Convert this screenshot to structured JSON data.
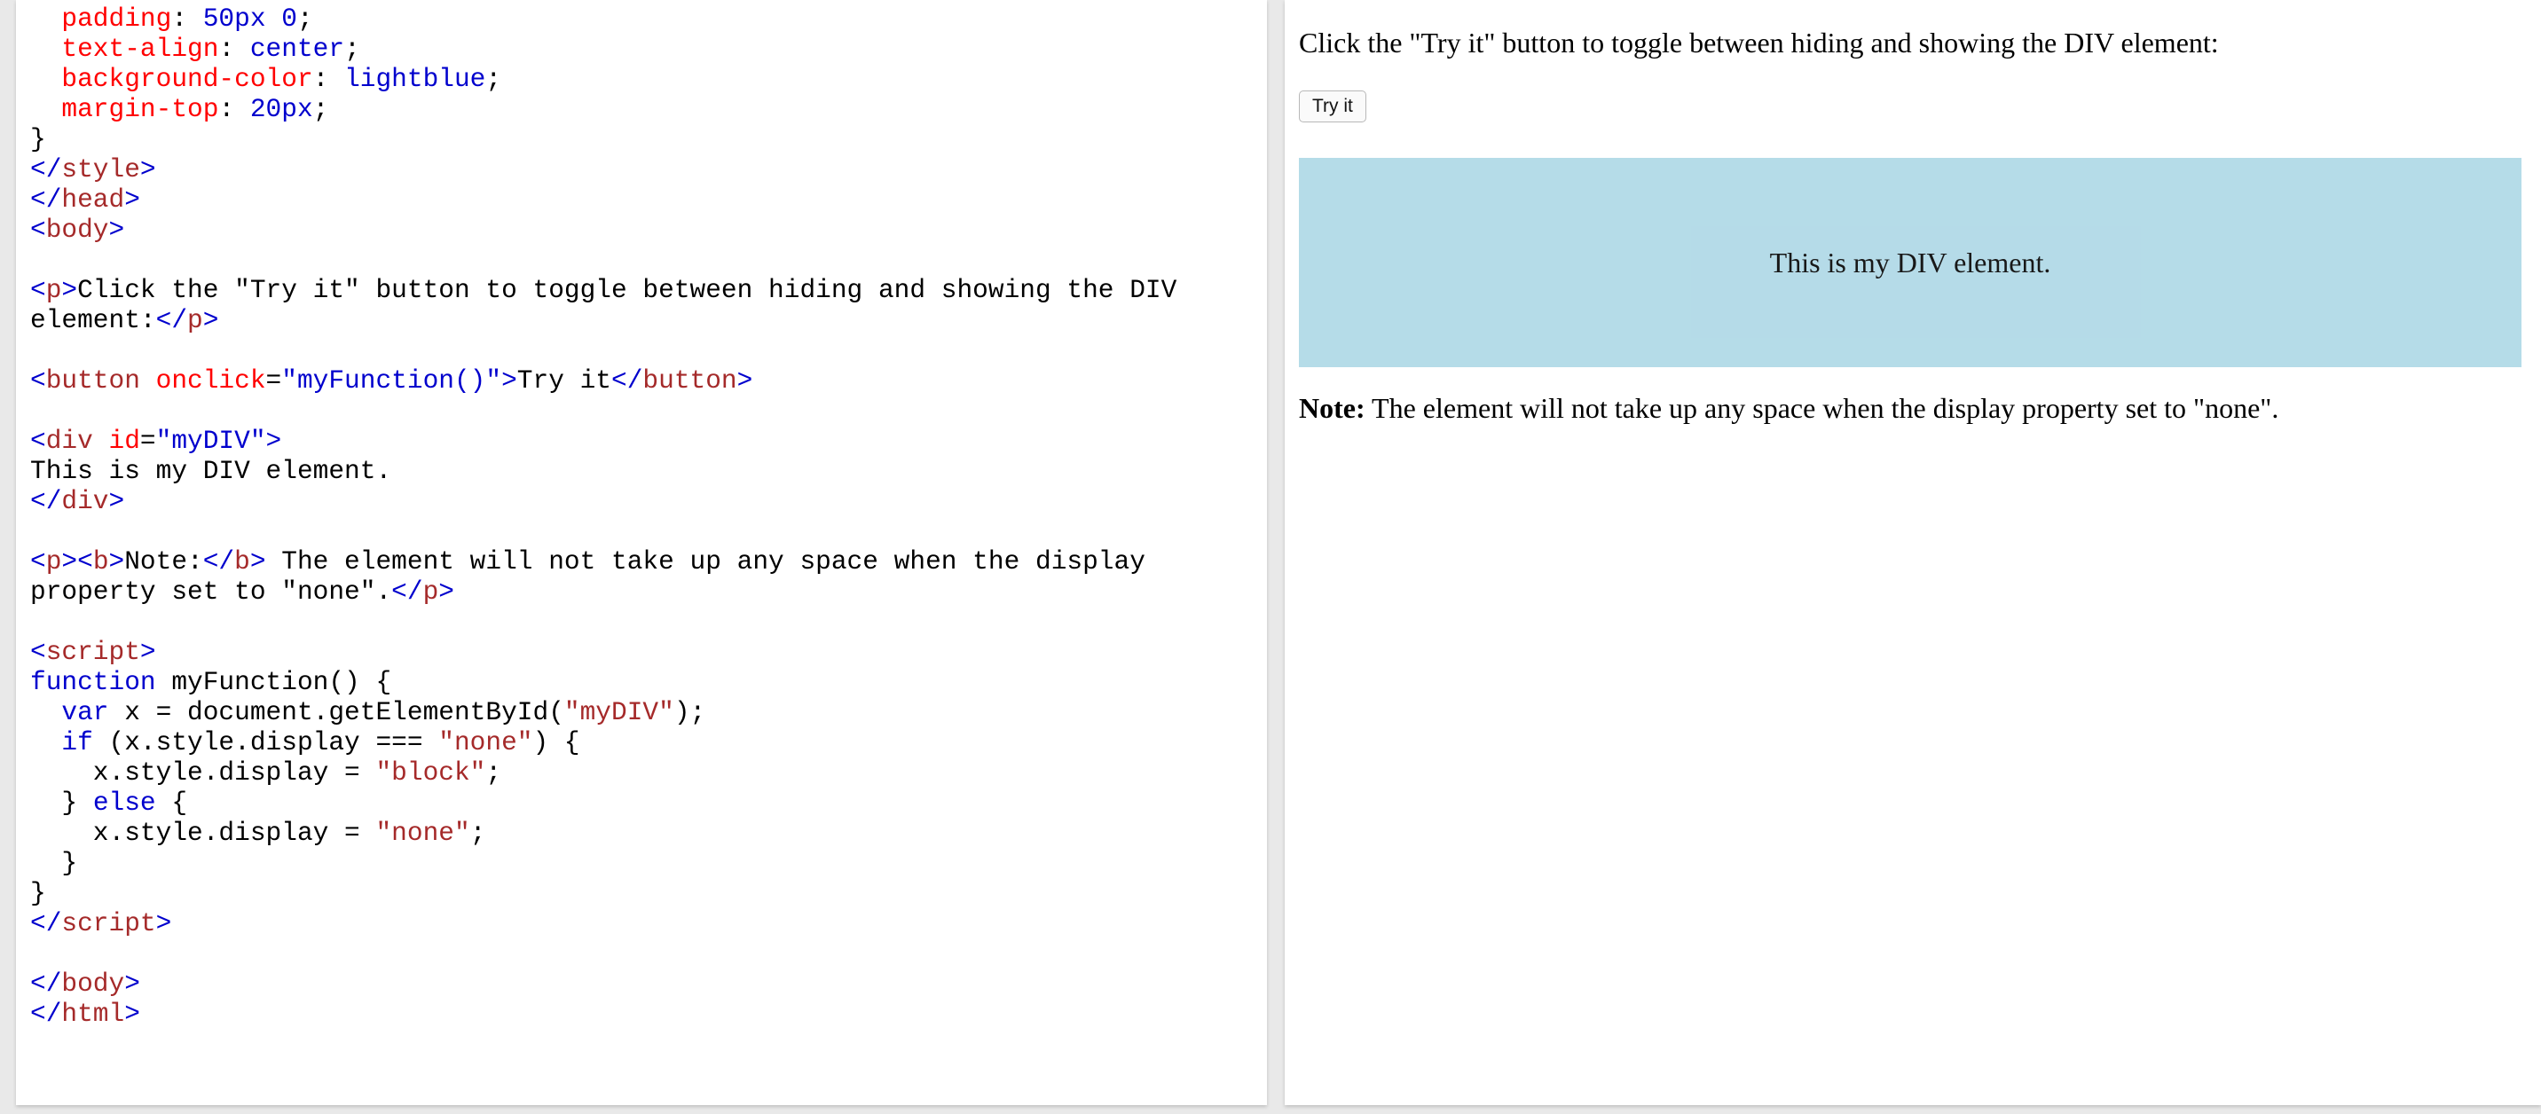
{
  "editor": {
    "lines": [
      [
        {
          "t": "  "
        },
        {
          "c": "cssprop",
          "t": "padding"
        },
        {
          "t": ": "
        },
        {
          "c": "cssval",
          "t": "50px 0"
        },
        {
          "t": ";"
        }
      ],
      [
        {
          "t": "  "
        },
        {
          "c": "cssprop",
          "t": "text-align"
        },
        {
          "t": ": "
        },
        {
          "c": "cssval",
          "t": "center"
        },
        {
          "t": ";"
        }
      ],
      [
        {
          "t": "  "
        },
        {
          "c": "cssprop",
          "t": "background-color"
        },
        {
          "t": ": "
        },
        {
          "c": "cssval",
          "t": "lightblue"
        },
        {
          "t": ";"
        }
      ],
      [
        {
          "t": "  "
        },
        {
          "c": "cssprop",
          "t": "margin-top"
        },
        {
          "t": ": "
        },
        {
          "c": "cssval",
          "t": "20px"
        },
        {
          "t": ";"
        }
      ],
      [
        {
          "t": "}"
        }
      ],
      [
        {
          "c": "tag",
          "t": "</"
        },
        {
          "c": "tagname",
          "t": "style"
        },
        {
          "c": "tag",
          "t": ">"
        }
      ],
      [
        {
          "c": "tag",
          "t": "</"
        },
        {
          "c": "tagname",
          "t": "head"
        },
        {
          "c": "tag",
          "t": ">"
        }
      ],
      [
        {
          "c": "tag",
          "t": "<"
        },
        {
          "c": "tagname",
          "t": "body"
        },
        {
          "c": "tag",
          "t": ">"
        }
      ],
      [],
      [
        {
          "c": "tag",
          "t": "<"
        },
        {
          "c": "tagname",
          "t": "p"
        },
        {
          "c": "tag",
          "t": ">"
        },
        {
          "t": "Click the \"Try it\" button to toggle between hiding and showing the DIV"
        }
      ],
      [
        {
          "t": "element:"
        },
        {
          "c": "tag",
          "t": "</"
        },
        {
          "c": "tagname",
          "t": "p"
        },
        {
          "c": "tag",
          "t": ">"
        }
      ],
      [],
      [
        {
          "c": "tag",
          "t": "<"
        },
        {
          "c": "tagname",
          "t": "button"
        },
        {
          "t": " "
        },
        {
          "c": "attr",
          "t": "onclick"
        },
        {
          "t": "="
        },
        {
          "c": "attrval",
          "t": "\"myFunction()\""
        },
        {
          "c": "tag",
          "t": ">"
        },
        {
          "t": "Try it"
        },
        {
          "c": "tag",
          "t": "</"
        },
        {
          "c": "tagname",
          "t": "button"
        },
        {
          "c": "tag",
          "t": ">"
        }
      ],
      [],
      [
        {
          "c": "tag",
          "t": "<"
        },
        {
          "c": "tagname",
          "t": "div"
        },
        {
          "t": " "
        },
        {
          "c": "attr",
          "t": "id"
        },
        {
          "t": "="
        },
        {
          "c": "attrval",
          "t": "\"myDIV\""
        },
        {
          "c": "tag",
          "t": ">"
        }
      ],
      [
        {
          "t": "This is my DIV element."
        }
      ],
      [
        {
          "c": "tag",
          "t": "</"
        },
        {
          "c": "tagname",
          "t": "div"
        },
        {
          "c": "tag",
          "t": ">"
        }
      ],
      [],
      [
        {
          "c": "tag",
          "t": "<"
        },
        {
          "c": "tagname",
          "t": "p"
        },
        {
          "c": "tag",
          "t": "><"
        },
        {
          "c": "tagname",
          "t": "b"
        },
        {
          "c": "tag",
          "t": ">"
        },
        {
          "t": "Note:"
        },
        {
          "c": "tag",
          "t": "</"
        },
        {
          "c": "tagname",
          "t": "b"
        },
        {
          "c": "tag",
          "t": ">"
        },
        {
          "t": " The element will not take up any space when the display"
        }
      ],
      [
        {
          "t": "property set to \"none\"."
        },
        {
          "c": "tag",
          "t": "</"
        },
        {
          "c": "tagname",
          "t": "p"
        },
        {
          "c": "tag",
          "t": ">"
        }
      ],
      [],
      [
        {
          "c": "tag",
          "t": "<"
        },
        {
          "c": "tagname",
          "t": "script"
        },
        {
          "c": "tag",
          "t": ">"
        }
      ],
      [
        {
          "c": "kw",
          "t": "function"
        },
        {
          "t": " myFunction() {"
        }
      ],
      [
        {
          "t": "  "
        },
        {
          "c": "kw",
          "t": "var"
        },
        {
          "t": " x = document.getElementById("
        },
        {
          "c": "str",
          "t": "\"myDIV\""
        },
        {
          "t": ");"
        }
      ],
      [
        {
          "t": "  "
        },
        {
          "c": "kw",
          "t": "if"
        },
        {
          "t": " (x.style.display === "
        },
        {
          "c": "str",
          "t": "\"none\""
        },
        {
          "t": ") {"
        }
      ],
      [
        {
          "t": "    x.style.display = "
        },
        {
          "c": "str",
          "t": "\"block\""
        },
        {
          "t": ";"
        }
      ],
      [
        {
          "t": "  } "
        },
        {
          "c": "kw",
          "t": "else"
        },
        {
          "t": " {"
        }
      ],
      [
        {
          "t": "    x.style.display = "
        },
        {
          "c": "str",
          "t": "\"none\""
        },
        {
          "t": ";"
        }
      ],
      [
        {
          "t": "  }"
        }
      ],
      [
        {
          "t": "}"
        }
      ],
      [
        {
          "c": "tag",
          "t": "</"
        },
        {
          "c": "tagname",
          "t": "script"
        },
        {
          "c": "tag",
          "t": ">"
        }
      ],
      [],
      [
        {
          "c": "tag",
          "t": "</"
        },
        {
          "c": "tagname",
          "t": "body"
        },
        {
          "c": "tag",
          "t": ">"
        }
      ],
      [
        {
          "c": "tag",
          "t": "</"
        },
        {
          "c": "tagname",
          "t": "html"
        },
        {
          "c": "tag",
          "t": ">"
        }
      ]
    ]
  },
  "result": {
    "intro_text": "Click the \"Try it\" button to toggle between hiding and showing the DIV element:",
    "button_label": "Try it",
    "div_text": "This is my DIV element.",
    "note_label": "Note:",
    "note_text": " The element will not take up any space when the display property set to \"none\"."
  }
}
